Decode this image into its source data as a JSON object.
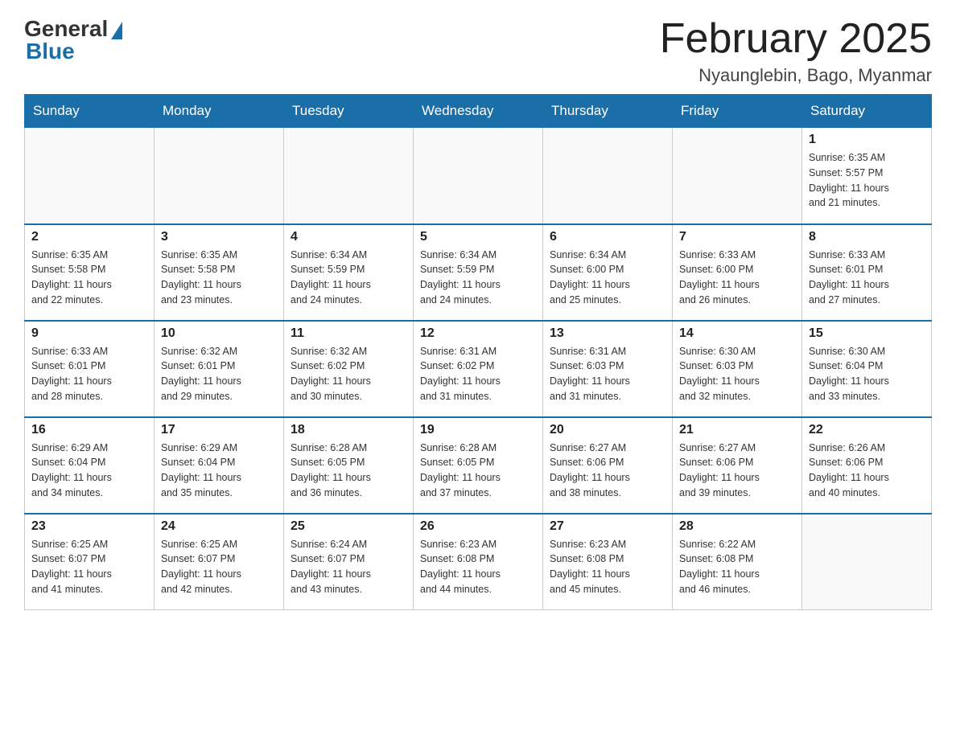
{
  "logo": {
    "general": "General",
    "blue": "Blue"
  },
  "title": "February 2025",
  "location": "Nyaunglebin, Bago, Myanmar",
  "days_of_week": [
    "Sunday",
    "Monday",
    "Tuesday",
    "Wednesday",
    "Thursday",
    "Friday",
    "Saturday"
  ],
  "weeks": [
    [
      {
        "day": "",
        "info": ""
      },
      {
        "day": "",
        "info": ""
      },
      {
        "day": "",
        "info": ""
      },
      {
        "day": "",
        "info": ""
      },
      {
        "day": "",
        "info": ""
      },
      {
        "day": "",
        "info": ""
      },
      {
        "day": "1",
        "info": "Sunrise: 6:35 AM\nSunset: 5:57 PM\nDaylight: 11 hours\nand 21 minutes."
      }
    ],
    [
      {
        "day": "2",
        "info": "Sunrise: 6:35 AM\nSunset: 5:58 PM\nDaylight: 11 hours\nand 22 minutes."
      },
      {
        "day": "3",
        "info": "Sunrise: 6:35 AM\nSunset: 5:58 PM\nDaylight: 11 hours\nand 23 minutes."
      },
      {
        "day": "4",
        "info": "Sunrise: 6:34 AM\nSunset: 5:59 PM\nDaylight: 11 hours\nand 24 minutes."
      },
      {
        "day": "5",
        "info": "Sunrise: 6:34 AM\nSunset: 5:59 PM\nDaylight: 11 hours\nand 24 minutes."
      },
      {
        "day": "6",
        "info": "Sunrise: 6:34 AM\nSunset: 6:00 PM\nDaylight: 11 hours\nand 25 minutes."
      },
      {
        "day": "7",
        "info": "Sunrise: 6:33 AM\nSunset: 6:00 PM\nDaylight: 11 hours\nand 26 minutes."
      },
      {
        "day": "8",
        "info": "Sunrise: 6:33 AM\nSunset: 6:01 PM\nDaylight: 11 hours\nand 27 minutes."
      }
    ],
    [
      {
        "day": "9",
        "info": "Sunrise: 6:33 AM\nSunset: 6:01 PM\nDaylight: 11 hours\nand 28 minutes."
      },
      {
        "day": "10",
        "info": "Sunrise: 6:32 AM\nSunset: 6:01 PM\nDaylight: 11 hours\nand 29 minutes."
      },
      {
        "day": "11",
        "info": "Sunrise: 6:32 AM\nSunset: 6:02 PM\nDaylight: 11 hours\nand 30 minutes."
      },
      {
        "day": "12",
        "info": "Sunrise: 6:31 AM\nSunset: 6:02 PM\nDaylight: 11 hours\nand 31 minutes."
      },
      {
        "day": "13",
        "info": "Sunrise: 6:31 AM\nSunset: 6:03 PM\nDaylight: 11 hours\nand 31 minutes."
      },
      {
        "day": "14",
        "info": "Sunrise: 6:30 AM\nSunset: 6:03 PM\nDaylight: 11 hours\nand 32 minutes."
      },
      {
        "day": "15",
        "info": "Sunrise: 6:30 AM\nSunset: 6:04 PM\nDaylight: 11 hours\nand 33 minutes."
      }
    ],
    [
      {
        "day": "16",
        "info": "Sunrise: 6:29 AM\nSunset: 6:04 PM\nDaylight: 11 hours\nand 34 minutes."
      },
      {
        "day": "17",
        "info": "Sunrise: 6:29 AM\nSunset: 6:04 PM\nDaylight: 11 hours\nand 35 minutes."
      },
      {
        "day": "18",
        "info": "Sunrise: 6:28 AM\nSunset: 6:05 PM\nDaylight: 11 hours\nand 36 minutes."
      },
      {
        "day": "19",
        "info": "Sunrise: 6:28 AM\nSunset: 6:05 PM\nDaylight: 11 hours\nand 37 minutes."
      },
      {
        "day": "20",
        "info": "Sunrise: 6:27 AM\nSunset: 6:06 PM\nDaylight: 11 hours\nand 38 minutes."
      },
      {
        "day": "21",
        "info": "Sunrise: 6:27 AM\nSunset: 6:06 PM\nDaylight: 11 hours\nand 39 minutes."
      },
      {
        "day": "22",
        "info": "Sunrise: 6:26 AM\nSunset: 6:06 PM\nDaylight: 11 hours\nand 40 minutes."
      }
    ],
    [
      {
        "day": "23",
        "info": "Sunrise: 6:25 AM\nSunset: 6:07 PM\nDaylight: 11 hours\nand 41 minutes."
      },
      {
        "day": "24",
        "info": "Sunrise: 6:25 AM\nSunset: 6:07 PM\nDaylight: 11 hours\nand 42 minutes."
      },
      {
        "day": "25",
        "info": "Sunrise: 6:24 AM\nSunset: 6:07 PM\nDaylight: 11 hours\nand 43 minutes."
      },
      {
        "day": "26",
        "info": "Sunrise: 6:23 AM\nSunset: 6:08 PM\nDaylight: 11 hours\nand 44 minutes."
      },
      {
        "day": "27",
        "info": "Sunrise: 6:23 AM\nSunset: 6:08 PM\nDaylight: 11 hours\nand 45 minutes."
      },
      {
        "day": "28",
        "info": "Sunrise: 6:22 AM\nSunset: 6:08 PM\nDaylight: 11 hours\nand 46 minutes."
      },
      {
        "day": "",
        "info": ""
      }
    ]
  ]
}
